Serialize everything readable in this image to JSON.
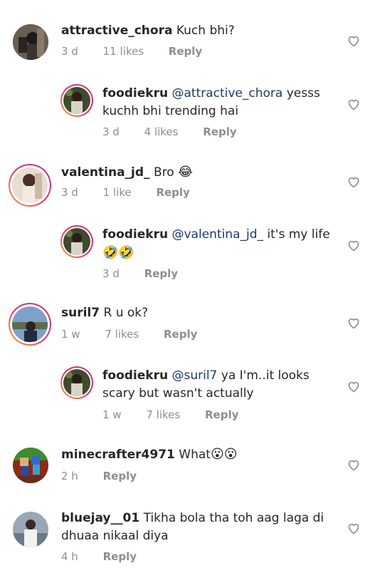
{
  "comments": [
    {
      "user": "attractive_chora",
      "text": "Kuch bhi?",
      "time": "3 d",
      "likes": "11 likes",
      "reply": "Reply"
    },
    {
      "user": "foodiekru",
      "mention": "@attractive_chora",
      "text": " yesss kuchh bhi trending hai",
      "time": "3 d",
      "likes": "4 likes",
      "reply": "Reply"
    },
    {
      "user": "valentina_jd_",
      "text": "Bro",
      "emoji": "😂",
      "time": "3 d",
      "likes": "1 like",
      "reply": "Reply"
    },
    {
      "user": "foodiekru",
      "mention": "@valentina_jd_",
      "text": " it's my life",
      "emoji": "🤣🤣",
      "time": "3 d",
      "reply": "Reply"
    },
    {
      "user": "suril7",
      "text": "R u ok?",
      "time": "1 w",
      "likes": "7 likes",
      "reply": "Reply"
    },
    {
      "user": "foodiekru",
      "mention": "@suril7",
      "text": " ya I'm..it looks scary but wasn't actually",
      "time": "1 w",
      "likes": "7 likes",
      "reply": "Reply"
    },
    {
      "user": "minecrafter4971",
      "text": "What",
      "emoji": "😮😮",
      "time": "2 h",
      "reply": "Reply"
    },
    {
      "user": "bluejay__01",
      "text": "Tikha bola tha toh aag laga di dhuaa nikaal diya",
      "time": "4 h",
      "reply": "Reply"
    }
  ],
  "colors": {
    "accent_ring_start": "#f9a63a",
    "accent_ring_end": "#c13584",
    "mention": "#1e3a68",
    "meta": "#8e8e8e"
  },
  "icons": {
    "like": "heart-outline-icon"
  }
}
